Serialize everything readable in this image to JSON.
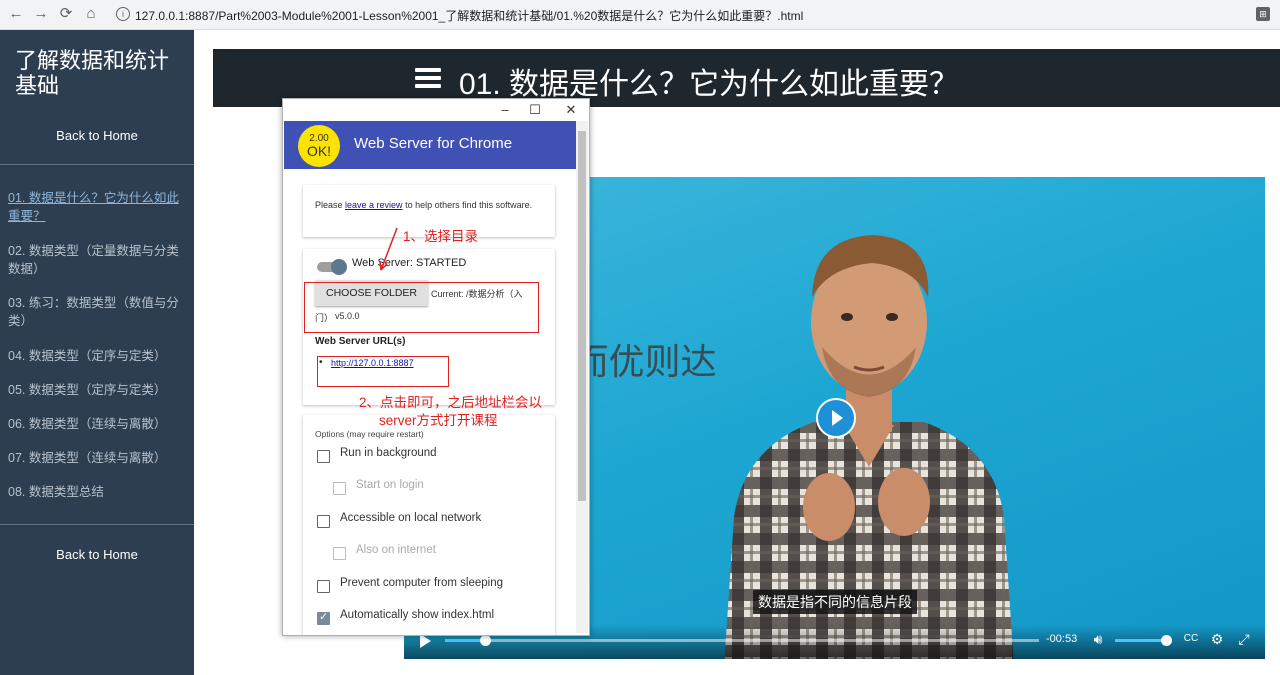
{
  "browser": {
    "back_icon": "←",
    "forward_icon": "→",
    "reload_icon": "⟳",
    "home_icon": "⌂",
    "info_icon": "i",
    "url": "127.0.0.1:8887/Part%2003-Module%2001-Lesson%2001_了解数据和统计基础/01.%20数据是什么？它为什么如此重要？.html",
    "extension_icon": "⊞"
  },
  "sidebar": {
    "title": "了解数据和统计基础",
    "back_home_top": "Back to Home",
    "back_home_bottom": "Back to Home",
    "lessons": [
      "01. 数据是什么？它为什么如此重要？",
      "02. 数据类型（定量数据与分类数据）",
      "03. 练习：数据类型（数值与分类）",
      "04. 数据类型（定序与定类）",
      "05. 数据类型（定序与定类）",
      "06. 数据类型（连续与离散）",
      "07. 数据类型（连续与离散）",
      "08. 数据类型总结"
    ]
  },
  "header": {
    "title": "01. 数据是什么？它为什么如此重要？"
  },
  "video": {
    "subtitle": "数据是指不同的信息片段",
    "time_remaining": "-00:53",
    "progress": 0.068,
    "volume": 0.9
  },
  "watermark": "@学而优则达",
  "popup": {
    "window_minimize": "–",
    "window_maximize": "☐",
    "window_close": "✕",
    "logo_line1": "2.00",
    "logo_line2": "OK!",
    "app_title": "Web Server for Chrome",
    "review_prefix": "Please ",
    "review_link": "leave a review",
    "review_suffix": " to help others find this software.",
    "server_status": "Web Server: STARTED",
    "choose_folder": "CHOOSE FOLDER",
    "current_folder": "Current: /数据分析（入",
    "current_folder_cont": "门）",
    "version": "v5.0.0",
    "urls_heading": "Web Server URL(s)",
    "server_url": "http://127.0.0.1:8887",
    "options_heading": "Options (may require restart)",
    "options": [
      {
        "label": "Run in background",
        "checked": false,
        "disabled": false
      },
      {
        "label": "Start on login",
        "checked": false,
        "disabled": true
      },
      {
        "label": "Accessible on local network",
        "checked": false,
        "disabled": false
      },
      {
        "label": "Also on internet",
        "checked": false,
        "disabled": true
      },
      {
        "label": "Prevent computer from sleeping",
        "checked": false,
        "disabled": false
      },
      {
        "label": "Automatically show index.html",
        "checked": true,
        "disabled": false
      }
    ]
  },
  "annotations": {
    "step1": "1、选择目录",
    "step2_line1": "2、点击即可，之后地址栏会以",
    "step2_line2": "server方式打开课程"
  },
  "colors": {
    "sidebar_bg": "#2c3e50",
    "header_bg": "#1e272e",
    "app_header": "#3f51b5",
    "annotation": "#e02020",
    "video_bg": "#1ea7d2"
  }
}
